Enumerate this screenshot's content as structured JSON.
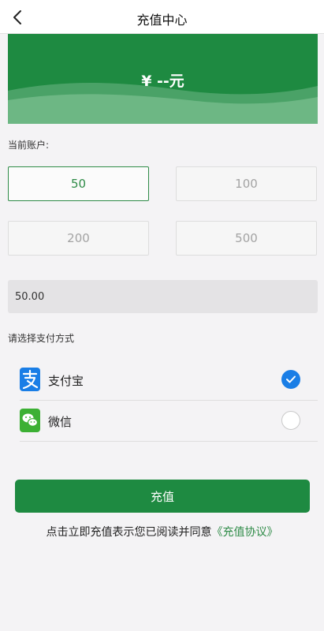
{
  "navbar": {
    "title": "充值中心"
  },
  "banner": {
    "balance": "¥ --元"
  },
  "account_label": "当前账户:",
  "amounts": [
    {
      "label": "50",
      "selected": true
    },
    {
      "label": "100",
      "selected": false
    },
    {
      "label": "200",
      "selected": false
    },
    {
      "label": "500",
      "selected": false
    }
  ],
  "custom_amount": {
    "value": "50.00"
  },
  "payment": {
    "label": "请选择支付方式",
    "methods": [
      {
        "name": "支付宝",
        "icon": "alipay-icon",
        "checked": true
      },
      {
        "name": "微信",
        "icon": "wechat-icon",
        "checked": false
      }
    ]
  },
  "submit": {
    "label": "充值"
  },
  "agreement": {
    "text": "点击立即充值表示您已阅读并同意",
    "link": "《充值协议》"
  },
  "colors": {
    "brand_green": "#1e8a41",
    "check_blue": "#1a7ee6",
    "background": "#f4f3f5"
  }
}
